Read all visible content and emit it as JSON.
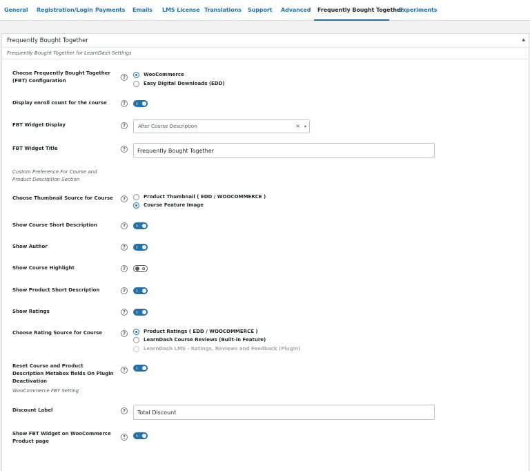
{
  "tabs": [
    {
      "label": "General"
    },
    {
      "label": "Registration/Login"
    },
    {
      "label": "Payments"
    },
    {
      "label": "Emails"
    },
    {
      "label": "LMS License"
    },
    {
      "label": "Translations"
    },
    {
      "label": "Support"
    },
    {
      "label": "Advanced"
    },
    {
      "label": "Frequently Bought Together",
      "active": true
    },
    {
      "label": "Experiments"
    }
  ],
  "panel": {
    "title": "Frequently Bought Together",
    "subtitle": "Frequently Bought Together for LearnDash Settings",
    "collapse_icon": "triangle-up-icon"
  },
  "help_icon": "?",
  "settings": {
    "fbt_config": {
      "label": "Choose Frequently Bought Together (FBT) Configuration",
      "options": [
        {
          "label": "WooCommerce",
          "checked": true
        },
        {
          "label": "Easy Digital Downloads (EDD)",
          "checked": false
        }
      ]
    },
    "enroll_count": {
      "label": "Display enroll count for the course",
      "on": true
    },
    "widget_display": {
      "label": "FBT Widget Display",
      "value": "After Course Description",
      "clear": "×",
      "caret": "▾"
    },
    "widget_title": {
      "label": "FBT Widget Title",
      "value": "Frequently Bought Together"
    },
    "section_custom_pref": "Custom Preference For Course and Product Description Section",
    "thumb_source": {
      "label": "Choose Thumbnail Source for Course",
      "options": [
        {
          "label": "Product Thumbnail ( EDD / WOOCOMMERCE )",
          "checked": false
        },
        {
          "label": "Course Feature Image",
          "checked": true
        }
      ]
    },
    "course_short_desc": {
      "label": "Show Course Short Description",
      "on": true
    },
    "author": {
      "label": "Show Author",
      "on": true
    },
    "course_highlight": {
      "label": "Show Course Highlight",
      "on": false
    },
    "product_short_desc": {
      "label": "Show Product Short Description",
      "on": true
    },
    "ratings": {
      "label": "Show Ratings",
      "on": true
    },
    "rating_source": {
      "label": "Choose Rating Source for Course",
      "options": [
        {
          "label": "Product Ratings ( EDD / WOOCOMMERCE )",
          "checked": true
        },
        {
          "label": "LearnDash Course Reviews (Built-in Feature)",
          "checked": false
        },
        {
          "label": "LearnDash LMS - Ratings, Reviews and Feedback (Plugin)",
          "checked": false,
          "disabled": true
        }
      ]
    },
    "reset_fields": {
      "label": "Reset Course and Product Description Metabox fields On Plugin Deactivation",
      "on": true
    },
    "section_woo": "WooCommerce FBT Setting",
    "discount_label": {
      "label": "Discount Label",
      "value": "Total Discount"
    },
    "woo_widget": {
      "label": "Show FBT Widget on WooCommerce Product page",
      "on": true
    }
  },
  "colors": {
    "accent": "#2271b1",
    "text": "#23282d",
    "muted": "#50575e",
    "background": "#f1f1f1"
  }
}
